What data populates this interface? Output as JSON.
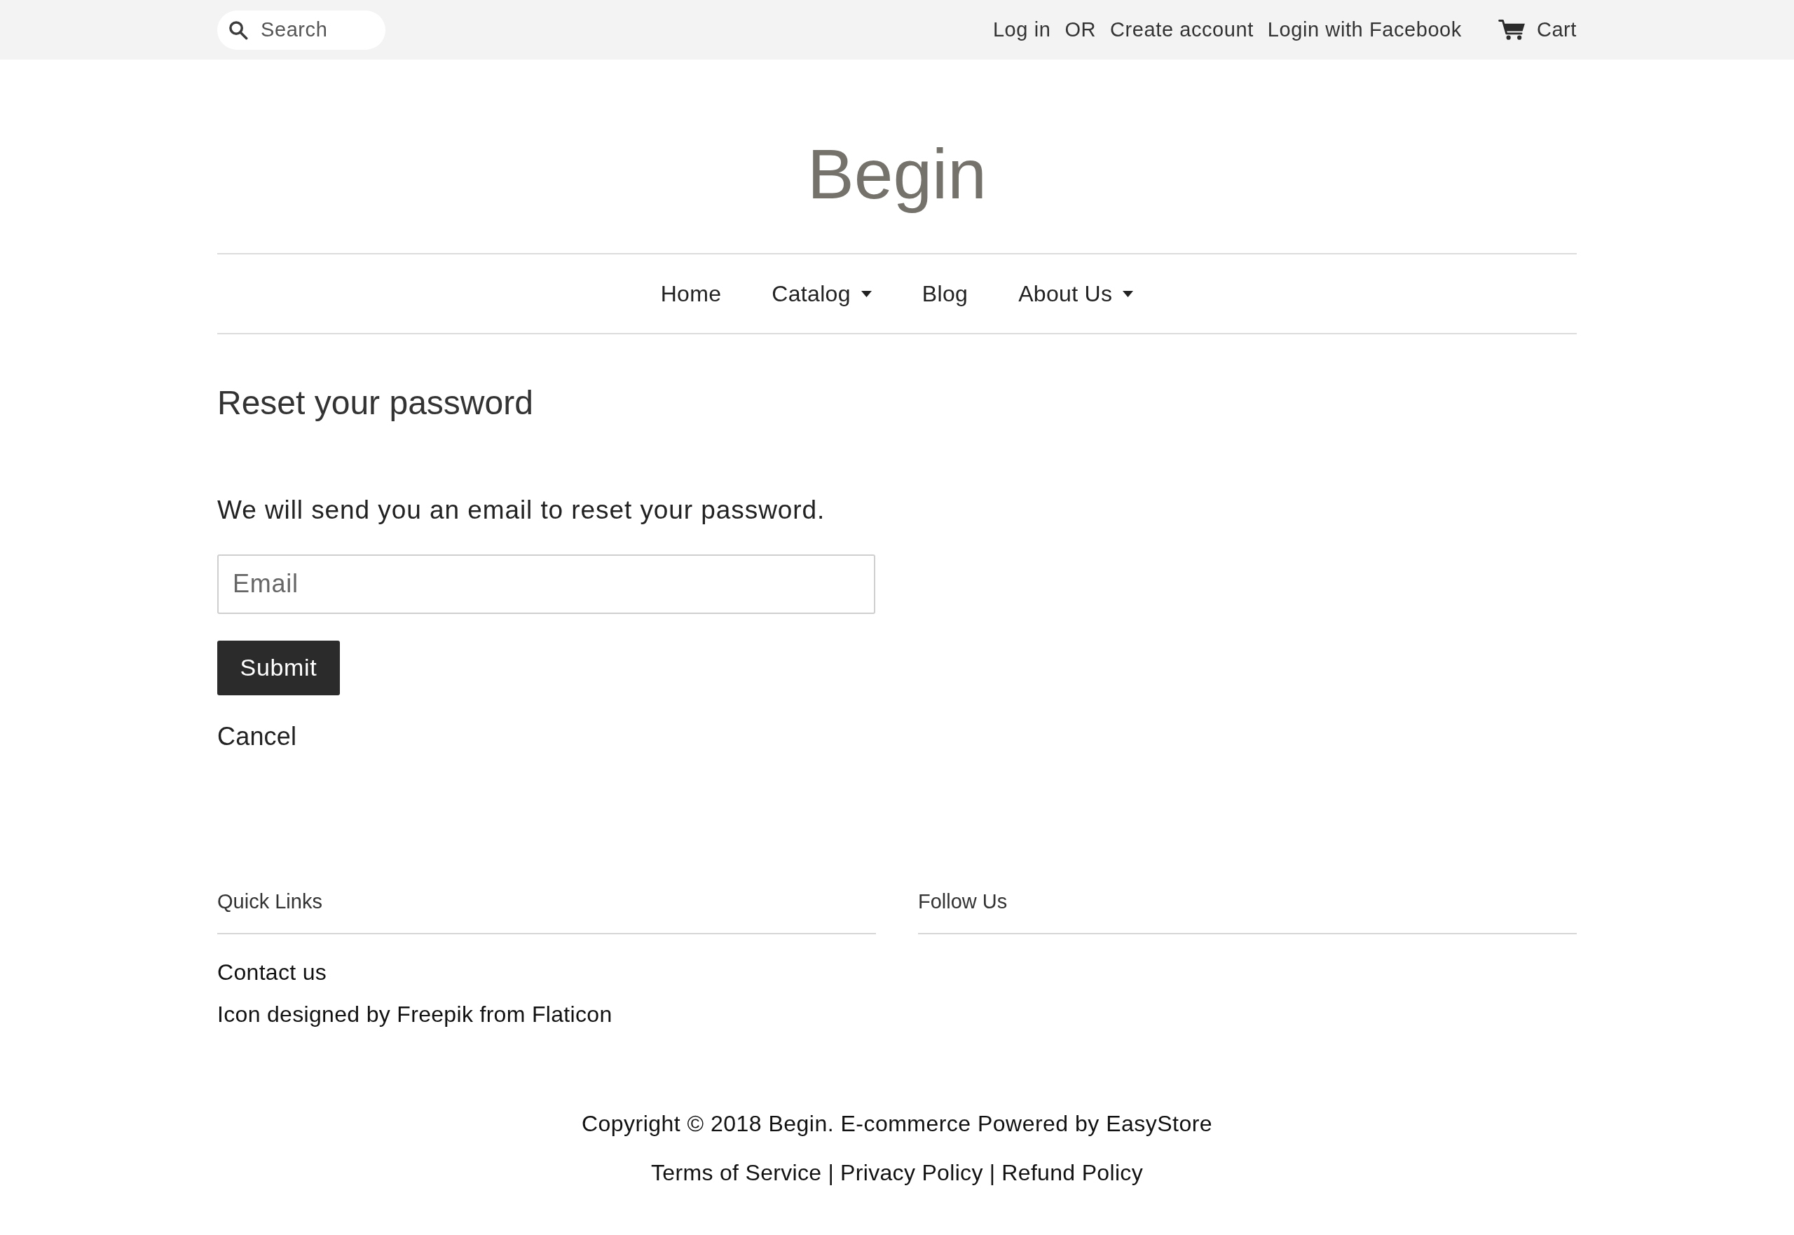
{
  "header_bar": {
    "search": {
      "placeholder": "Search"
    },
    "login_link": "Log in",
    "or_text": "OR",
    "create_account_link": "Create account",
    "facebook_link": "Login with Facebook",
    "cart": {
      "label": "Cart"
    }
  },
  "store": {
    "name": "Begin"
  },
  "nav": [
    {
      "label": "Home",
      "has_dropdown": false
    },
    {
      "label": "Catalog",
      "has_dropdown": true
    },
    {
      "label": "Blog",
      "has_dropdown": false
    },
    {
      "label": "About Us",
      "has_dropdown": true
    }
  ],
  "page": {
    "title": "Reset your password",
    "intro": "We will send you an email to reset your password.",
    "email_field": {
      "placeholder": "Email"
    },
    "submit": "Submit",
    "cancel": "Cancel"
  },
  "footer": {
    "columns": [
      {
        "heading": "Quick Links",
        "links": [
          "Contact us",
          "Icon designed by Freepik from Flaticon"
        ]
      },
      {
        "heading": "Follow Us"
      }
    ],
    "copyright": "Copyright © 2018 Begin. E-commerce Powered by EasyStore",
    "legal_links": [
      "Terms of Service",
      "Privacy Policy",
      "Refund Policy"
    ],
    "legal_separators": [
      "|",
      "|"
    ]
  }
}
